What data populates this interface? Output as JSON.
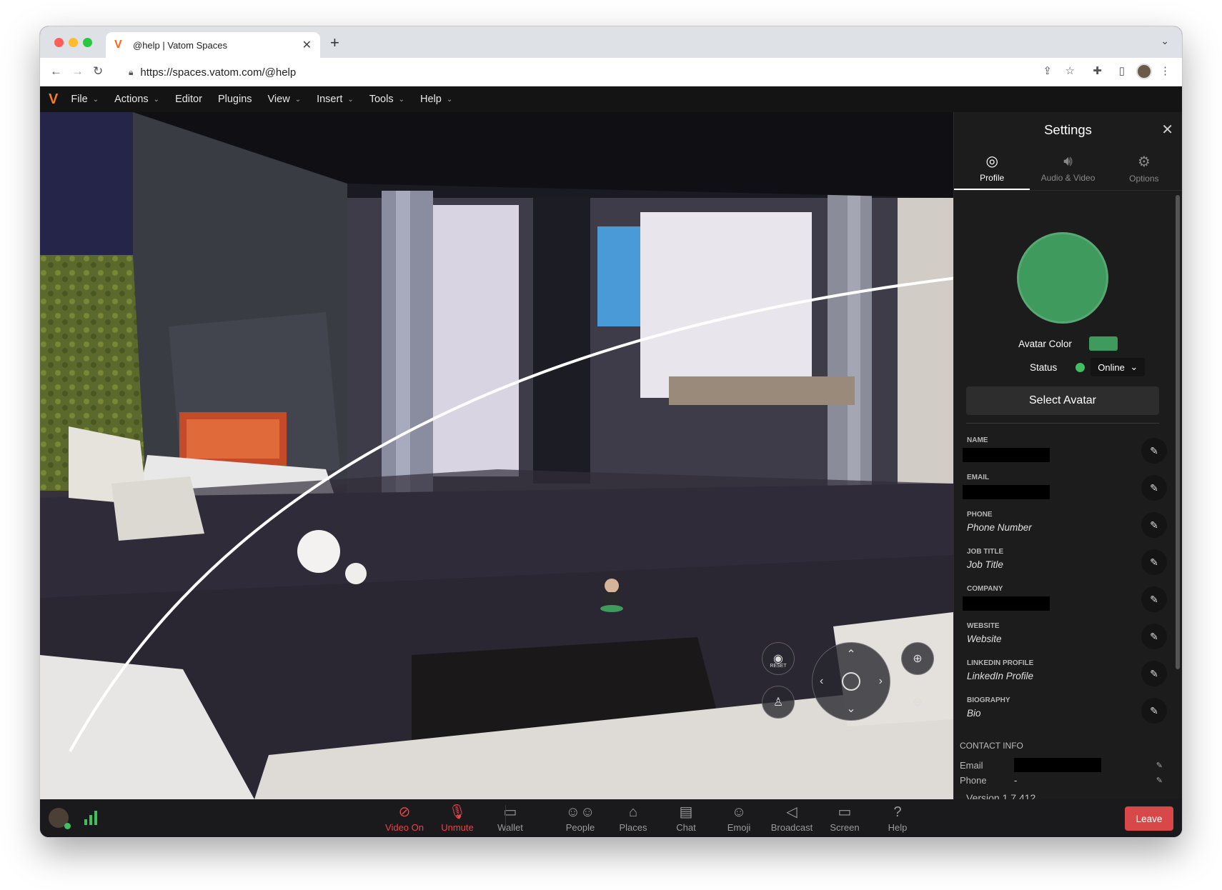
{
  "browser": {
    "tab_title": "@help | Vatom Spaces",
    "new_tab": "+",
    "url": "https://spaces.vatom.com/@help"
  },
  "menu": {
    "logo": "V",
    "items": [
      {
        "label": "File",
        "has_caret": true
      },
      {
        "label": "Actions",
        "has_caret": true
      },
      {
        "label": "Editor",
        "has_caret": false
      },
      {
        "label": "Plugins",
        "has_caret": false
      },
      {
        "label": "View",
        "has_caret": true
      },
      {
        "label": "Insert",
        "has_caret": true
      },
      {
        "label": "Tools",
        "has_caret": true
      },
      {
        "label": "Help",
        "has_caret": true
      }
    ]
  },
  "viewport": {
    "reset_label": "RESET"
  },
  "settings": {
    "title": "Settings",
    "tabs": [
      {
        "label": "Profile",
        "icon": "profile-icon",
        "active": true
      },
      {
        "label": "Audio & Video",
        "icon": "speaker-icon",
        "active": false
      },
      {
        "label": "Options",
        "icon": "gear-icon",
        "active": false
      }
    ],
    "avatar_color_label": "Avatar Color",
    "avatar_color": "#3f9a5e",
    "status_label": "Status",
    "status_value": "Online",
    "select_avatar": "Select Avatar",
    "fields": [
      {
        "label": "NAME",
        "value": "",
        "redacted": true
      },
      {
        "label": "EMAIL",
        "value": "",
        "redacted": true
      },
      {
        "label": "PHONE",
        "value": "Phone Number",
        "redacted": false
      },
      {
        "label": "JOB TITLE",
        "value": "Job Title",
        "redacted": false
      },
      {
        "label": "COMPANY",
        "value": "",
        "redacted": true
      },
      {
        "label": "WEBSITE",
        "value": "Website",
        "redacted": false
      },
      {
        "label": "LINKEDIN PROFILE",
        "value": "LinkedIn Profile",
        "redacted": false
      },
      {
        "label": "BIOGRAPHY",
        "value": "Bio",
        "redacted": false
      }
    ],
    "contact_info_title": "CONTACT INFO",
    "contact": [
      {
        "key": "Email",
        "value": "",
        "redacted": true
      },
      {
        "key": "Phone",
        "value": "-",
        "redacted": false
      }
    ],
    "version": "Version 1.7.412"
  },
  "bottombar": {
    "items": [
      {
        "label": "Video On",
        "icon": "video-off-icon",
        "alert": true
      },
      {
        "label": "Unmute",
        "icon": "mic-off-icon",
        "alert": true
      },
      {
        "label": "Wallet",
        "icon": "wallet-icon",
        "alert": false
      },
      {
        "label": "People",
        "icon": "people-icon",
        "alert": false
      },
      {
        "label": "Places",
        "icon": "map-icon",
        "alert": false
      },
      {
        "label": "Chat",
        "icon": "chat-icon",
        "alert": false
      },
      {
        "label": "Emoji",
        "icon": "emoji-icon",
        "alert": false
      },
      {
        "label": "Broadcast",
        "icon": "megaphone-icon",
        "alert": false
      },
      {
        "label": "Screen",
        "icon": "screen-icon",
        "alert": false
      },
      {
        "label": "Help",
        "icon": "help-icon",
        "alert": false
      }
    ],
    "leave": "Leave"
  },
  "colors": {
    "accent_alert": "#e04848",
    "leave_button": "#d84848",
    "online": "#3fbf5f"
  }
}
